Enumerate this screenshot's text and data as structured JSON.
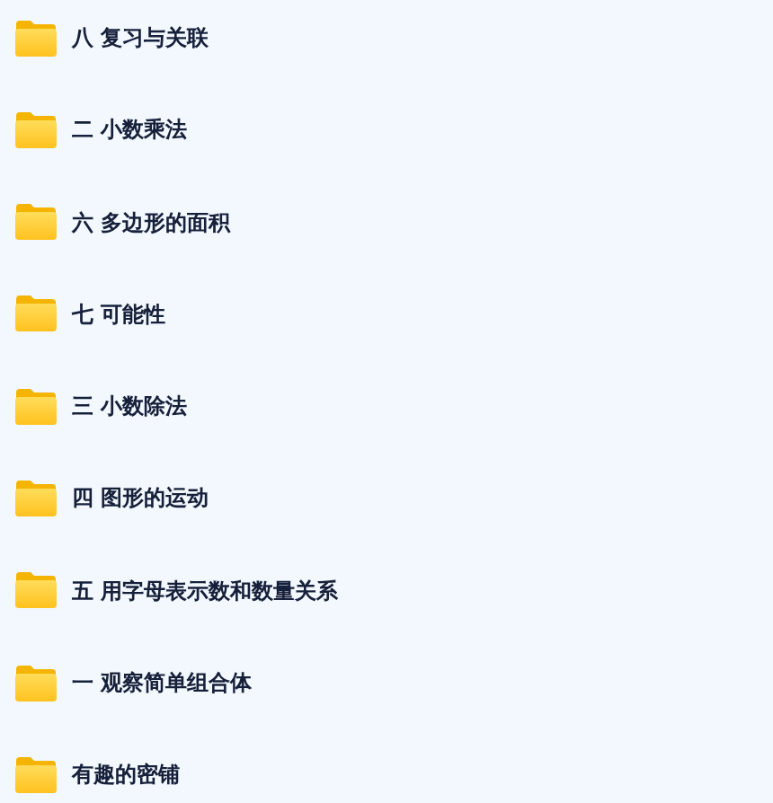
{
  "folders": [
    {
      "name": "八 复习与关联"
    },
    {
      "name": "二 小数乘法"
    },
    {
      "name": "六 多边形的面积"
    },
    {
      "name": "七 可能性"
    },
    {
      "name": "三 小数除法"
    },
    {
      "name": "四 图形的运动"
    },
    {
      "name": "五 用字母表示数和数量关系"
    },
    {
      "name": "一 观察简单组合体"
    },
    {
      "name": "有趣的密铺"
    }
  ]
}
